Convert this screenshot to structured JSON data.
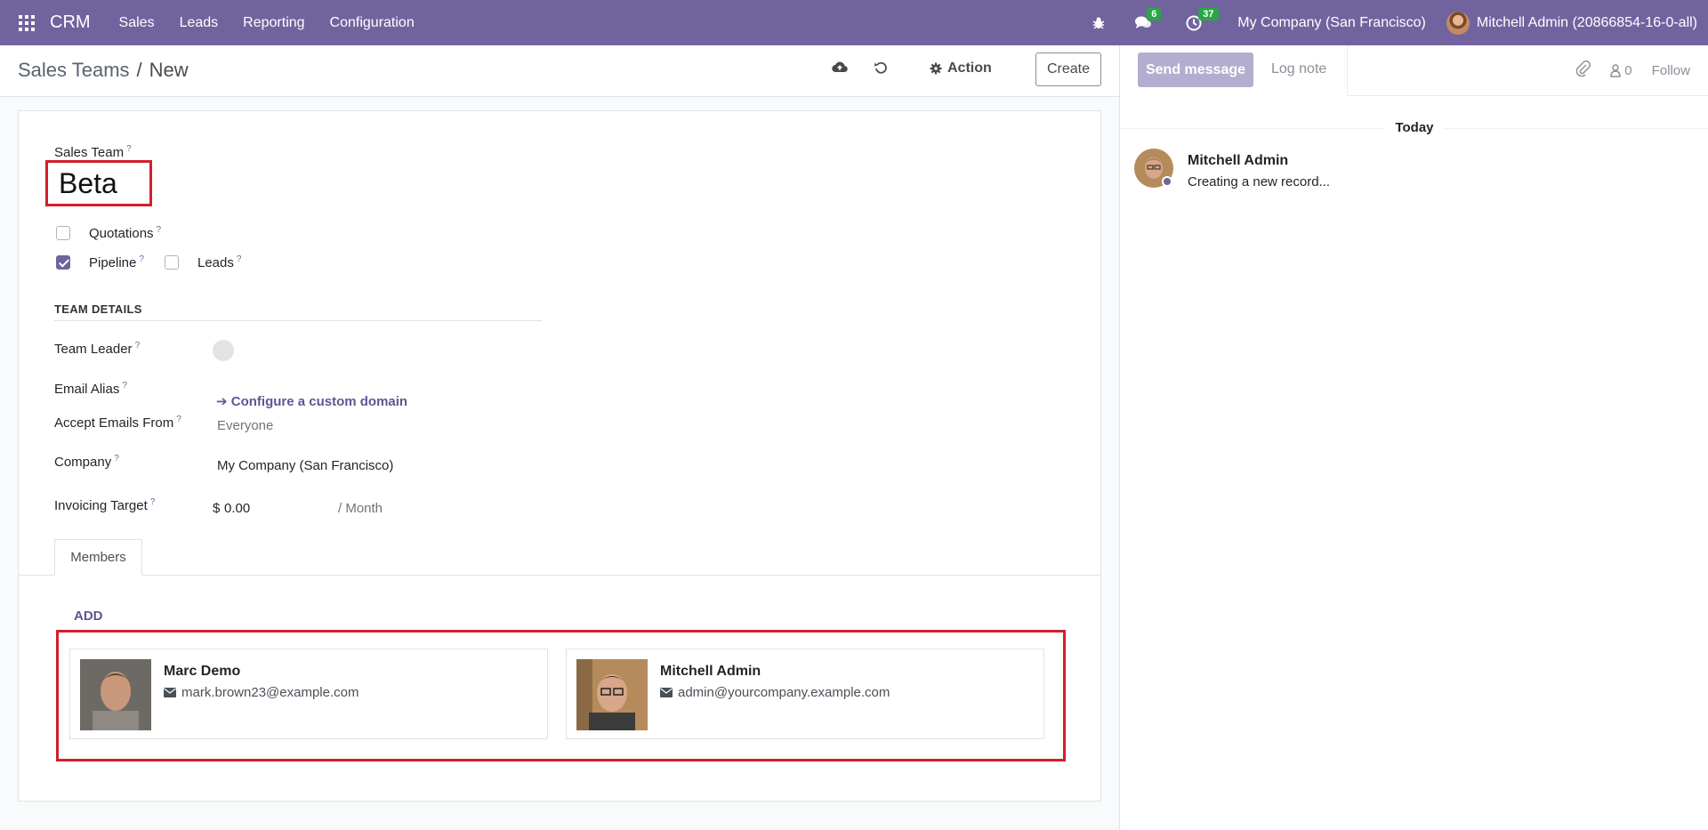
{
  "navbar": {
    "app_name": "CRM",
    "menu": [
      "Sales",
      "Leads",
      "Reporting",
      "Configuration"
    ],
    "messages_count": "6",
    "activities_count": "37",
    "company": "My Company (San Francisco)",
    "user": "Mitchell Admin (20866854-16-0-all)",
    "color": "#71639e"
  },
  "control_panel": {
    "breadcrumb_parent": "Sales Teams",
    "breadcrumb_sep": "/",
    "breadcrumb_current": "New",
    "action_label": "Action",
    "create_label": "Create"
  },
  "form": {
    "team_label": "Sales Team",
    "team_name": "Beta",
    "quotations_label": "Quotations",
    "quotations_checked": false,
    "pipeline_label": "Pipeline",
    "pipeline_checked": true,
    "leads_label": "Leads",
    "leads_checked": false,
    "section_title": "TEAM DETAILS",
    "team_leader_label": "Team Leader",
    "email_alias_label": "Email Alias",
    "configure_domain": "Configure a custom domain",
    "accept_emails_label": "Accept Emails From",
    "accept_emails_value": "Everyone",
    "company_label": "Company",
    "company_value": "My Company (San Francisco)",
    "invoicing_label": "Invoicing Target",
    "currency": "$",
    "invoicing_value": "0.00",
    "per_month": "/ Month",
    "help_mark": "?"
  },
  "tabs": {
    "members_tab": "Members",
    "add_label": "ADD"
  },
  "members": [
    {
      "name": "Marc Demo",
      "email": "mark.brown23@example.com"
    },
    {
      "name": "Mitchell Admin",
      "email": "admin@yourcompany.example.com"
    }
  ],
  "chatter": {
    "send_message": "Send message",
    "log_note": "Log note",
    "followers_count": "0",
    "follow_label": "Follow",
    "date_separator": "Today",
    "message_author": "Mitchell Admin",
    "message_body": "Creating a new record..."
  }
}
